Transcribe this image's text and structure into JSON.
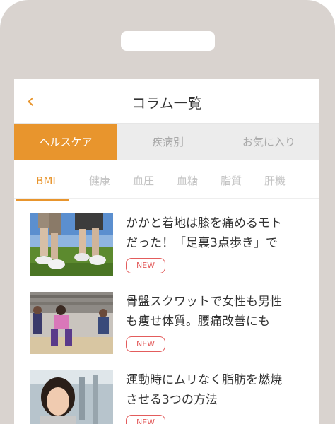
{
  "header": {
    "back_glyph": "‹",
    "title": "コラム一覧"
  },
  "segments": [
    {
      "label": "ヘルスケア",
      "active": true
    },
    {
      "label": "疾病別",
      "active": false
    },
    {
      "label": "お気に入り",
      "active": false
    }
  ],
  "subtabs": [
    {
      "label": "BMI",
      "active": true
    },
    {
      "label": "健康",
      "active": false
    },
    {
      "label": "血圧",
      "active": false
    },
    {
      "label": "血糖",
      "active": false
    },
    {
      "label": "脂質",
      "active": false
    },
    {
      "label": "肝機",
      "active": false
    }
  ],
  "articles": [
    {
      "title_line1": "かかと着地は膝を痛めるモト",
      "title_line2": "だった！「足裏3点歩き」で",
      "badge": "NEW"
    },
    {
      "title_line1": "骨盤スクワットで女性も男性",
      "title_line2": "も痩せ体質。腰痛改善にも",
      "badge": "NEW"
    },
    {
      "title_line1": "運動時にムリなく脂肪を燃焼",
      "title_line2": "させる3つの方法",
      "badge": "NEW"
    }
  ],
  "colors": {
    "accent": "#e8952d",
    "badge": "#e35c5c",
    "phone_frame": "#d9d3cf"
  }
}
